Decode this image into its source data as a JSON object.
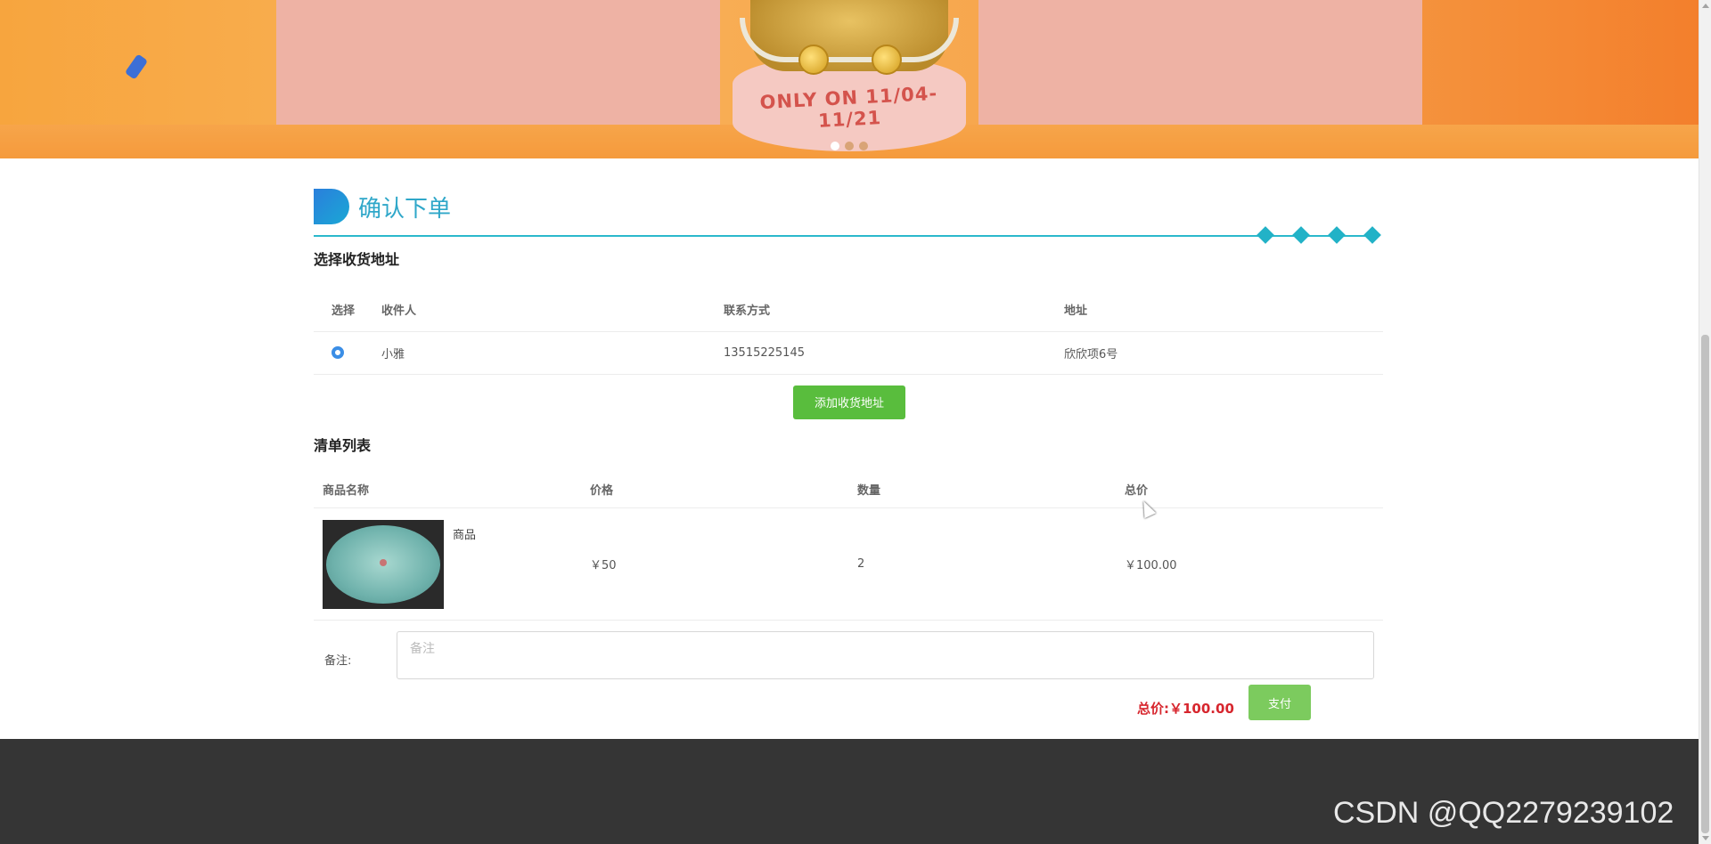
{
  "banner": {
    "slogan": "ONLY ON 11/04-11/21",
    "carousel_dots": 3,
    "active_dot": 0
  },
  "page_title": "确认下单",
  "address_section": {
    "title": "选择收货地址",
    "headers": [
      "选择",
      "收件人",
      "联系方式",
      "地址"
    ],
    "rows": [
      {
        "selected": true,
        "recipient": "小雅",
        "phone": "13515225145",
        "address": "欣欣项6号"
      }
    ],
    "add_button": "添加收货地址"
  },
  "order_section": {
    "title": "清单列表",
    "headers": [
      "商品名称",
      "价格",
      "数量",
      "总价"
    ],
    "items": [
      {
        "name": "商品",
        "price": "￥50",
        "quantity": "2",
        "total": "￥100.00"
      }
    ]
  },
  "remark": {
    "label": "备注:",
    "placeholder": "备注",
    "value": ""
  },
  "summary": {
    "total_label": "总价:",
    "total_value": "￥100.00",
    "pay_button": "支付"
  },
  "watermark": "CSDN @QQ2279239102",
  "colors": {
    "accent": "#2fa7c9",
    "add_button": "#59bd3d",
    "pay_button": "#7ccb5e",
    "total_text": "#d7262e",
    "footer": "#353535"
  }
}
